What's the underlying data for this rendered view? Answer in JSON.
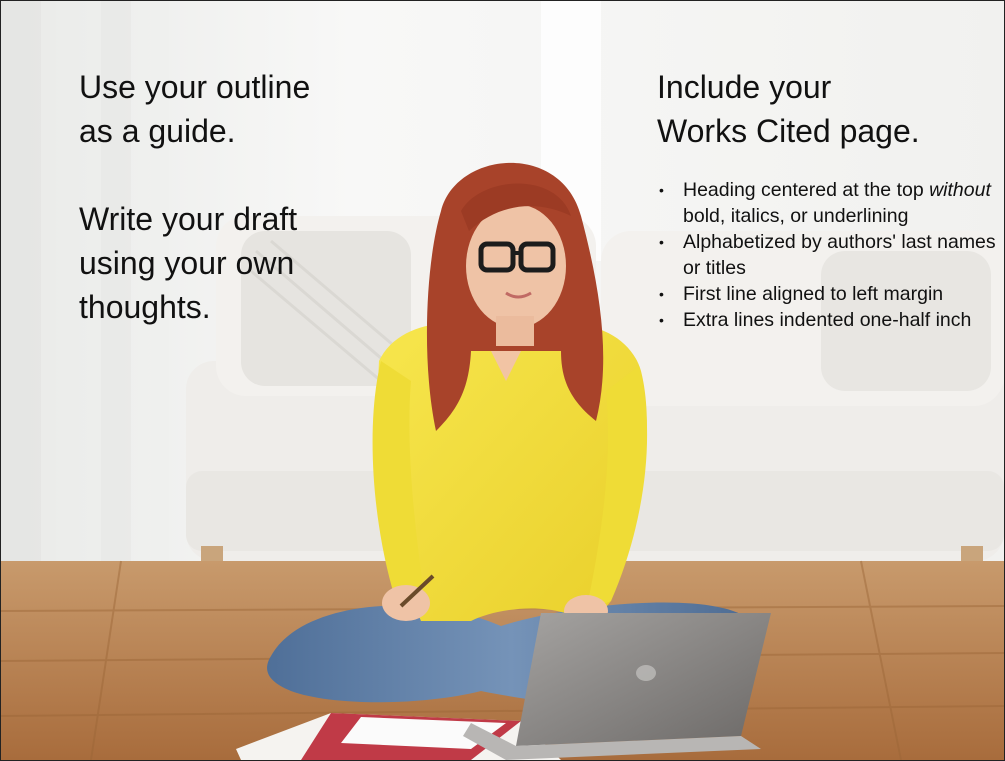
{
  "slide": {
    "left_block": {
      "paragraph1": [
        "Use your outline",
        "as a guide."
      ],
      "paragraph2": [
        "Write your draft",
        "using your own",
        "thoughts."
      ]
    },
    "right_block": {
      "title_lines": [
        "Include your",
        "Works Cited page."
      ],
      "bullets": [
        {
          "pre": "Heading centered at the top ",
          "em": "without",
          "post": " bold, italics, or underlining"
        },
        {
          "pre": "Alphabetized by authors' last names or titles",
          "em": "",
          "post": ""
        },
        {
          "pre": "First line aligned to left margin",
          "em": "",
          "post": ""
        },
        {
          "pre": "Extra lines indented one-half inch",
          "em": "",
          "post": ""
        }
      ]
    },
    "bullet_glyph": "•"
  },
  "photo": {
    "description_icon": "woman-on-floor-with-laptop-photo",
    "colors": {
      "wall": "#f4f4f2",
      "curtain": "#fbfbfb",
      "sofa": "#f1efec",
      "floor": "#b98455",
      "shirt": "#f3df3a",
      "jeans": "#5d7ea6",
      "hair": "#a8432a",
      "skin": "#efc3a6",
      "laptop": "#8d8a88"
    }
  }
}
